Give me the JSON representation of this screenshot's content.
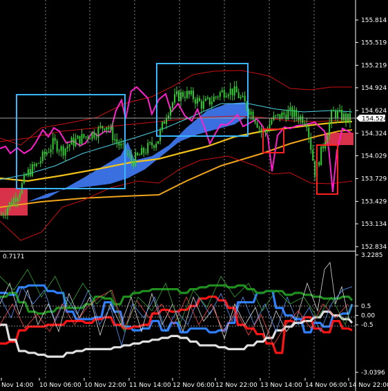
{
  "colors": {
    "background": "#000000",
    "grid": "#c0c0c0",
    "axis_text": "#ffffff",
    "candle": "#33cc33",
    "cloud_blue": "#3a6fe0",
    "cloud_red": "#d8324a",
    "ma_yellow": "#f2c21b",
    "ma_orange": "#f0a51c",
    "bb_red": "#cc1111",
    "magenta": "#ff1fcc",
    "box_cyan": "#38b6ff",
    "box_red": "#ff2020",
    "osc_blue": "#2f80ff",
    "osc_red": "#ff1414",
    "osc_green": "#1f8f1f",
    "osc_white": "#e0e0e0"
  },
  "icons": {
    "price_marker": "price-flag-icon"
  },
  "price_panel": {
    "axis_labels": [
      "155.814",
      "155.519",
      "155.219",
      "154.924",
      "154.624",
      "154.324",
      "154.029",
      "153.729",
      "153.429",
      "153.134",
      "152.834"
    ],
    "current_price": "154.524"
  },
  "indicator_panel": {
    "value_label": "0.7171",
    "axis_labels": [
      "3.2285",
      "0.5",
      "0.00",
      "-0.5",
      "-3.0396"
    ]
  },
  "time_axis": {
    "labels": [
      "Nov 14:00",
      "10 Nov 06:00",
      "10 Nov 22:00",
      "11 Nov 14:00",
      "12 Nov 06:00",
      "12 Nov 22:00",
      "13 Nov 14:00",
      "14 Nov 06:00",
      "14 Nov 22:00"
    ]
  },
  "chart_data": [
    {
      "type": "candlestick",
      "title": "",
      "y_axis_ticks": [
        155.814,
        155.519,
        155.219,
        154.924,
        154.624,
        154.324,
        154.029,
        153.729,
        153.429,
        153.134,
        152.834
      ],
      "ylim": [
        152.834,
        155.814
      ],
      "current_price": 154.524,
      "x_ticks": [
        "Nov 14:00",
        "10 Nov 06:00",
        "10 Nov 22:00",
        "11 Nov 14:00",
        "12 Nov 06:00",
        "12 Nov 22:00",
        "13 Nov 14:00",
        "14 Nov 06:00",
        "14 Nov 22:00"
      ],
      "close_path": [
        153.25,
        153.4,
        153.55,
        153.8,
        153.9,
        154.05,
        154.2,
        154.1,
        154.2,
        154.25,
        154.3,
        154.35,
        154.45,
        154.25,
        154.1,
        153.95,
        154.05,
        154.15,
        154.25,
        154.6,
        154.8,
        154.85,
        154.8,
        154.7,
        154.75,
        154.85,
        154.9,
        154.85,
        154.7,
        154.55,
        154.3,
        154.5,
        154.55,
        154.6,
        154.55,
        154.5,
        153.8,
        154.2,
        154.6,
        154.55,
        154.5
      ],
      "grid": true,
      "legend": "none"
    },
    {
      "type": "line",
      "title": "",
      "y_axis_ticks": [
        3.2285,
        0.5,
        0.0,
        -0.5,
        -3.0396
      ],
      "ylim": [
        -3.0396,
        3.2285
      ],
      "header_value": 0.7171,
      "series": [
        {
          "color": "#2f80ff",
          "values": [
            1.2,
            1.1,
            1.5,
            1.6,
            1.6,
            1.3,
            1.2,
            0.2,
            -0.2,
            -0.2,
            -0.1,
            0.7,
            0.2,
            -0.6,
            -0.8,
            -0.7,
            -0.3,
            -0.8,
            -0.4,
            -0.9,
            -0.7,
            -0.7,
            -0.9,
            -0.8,
            -0.4,
            0.7,
            0.7,
            1.2,
            1.3,
            0.4,
            0.0,
            -0.2,
            -0.9,
            -0.4,
            -0.6,
            0.0,
            0.1,
            0.6
          ]
        },
        {
          "color": "#ff1414",
          "values": [
            -1.5,
            -1.4,
            -0.8,
            -0.6,
            -0.6,
            -0.5,
            -0.5,
            -0.3,
            -0.3,
            -0.4,
            -0.2,
            -0.1,
            -0.5,
            -0.7,
            -0.6,
            -0.5,
            0.1,
            0.3,
            0.2,
            0.3,
            0.5,
            0.9,
            1.0,
            0.8,
            0.4,
            -0.5,
            -0.7,
            -1.0,
            -1.5,
            -2.0,
            -0.3,
            -0.4,
            -0.1,
            -0.7,
            -0.9,
            -0.3,
            -0.7,
            -0.8
          ]
        },
        {
          "color": "#1f8f1f",
          "values": [
            1.0,
            1.2,
            0.7,
            0.2,
            0.1,
            0.2,
            0.4,
            0.4,
            0.4,
            0.6,
            1.0,
            0.9,
            0.6,
            1.0,
            1.2,
            1.3,
            1.4,
            1.4,
            1.4,
            1.2,
            1.4,
            1.5,
            1.6,
            1.6,
            1.5,
            1.6,
            1.4,
            1.2,
            1.3,
            1.3,
            1.1,
            1.2,
            1.1,
            1.0,
            0.9,
            0.9,
            1.0,
            0.8
          ]
        },
        {
          "color": "#e0e0e0",
          "values": [
            -0.5,
            -1.3,
            -1.9,
            -2.0,
            -2.1,
            -2.2,
            -2.2,
            -2.0,
            -1.9,
            -1.8,
            -1.8,
            -1.8,
            -1.7,
            -1.6,
            -1.5,
            -1.4,
            -1.3,
            -1.2,
            -1.1,
            -1.2,
            -1.4,
            -1.6,
            -1.6,
            -1.7,
            -1.8,
            -1.8,
            -1.6,
            -1.4,
            -1.2,
            -0.8,
            -0.6,
            -0.4,
            -0.3,
            -0.1,
            0.2,
            0.0,
            -0.2,
            -0.4
          ]
        }
      ],
      "grid": true,
      "legend": "none"
    }
  ]
}
